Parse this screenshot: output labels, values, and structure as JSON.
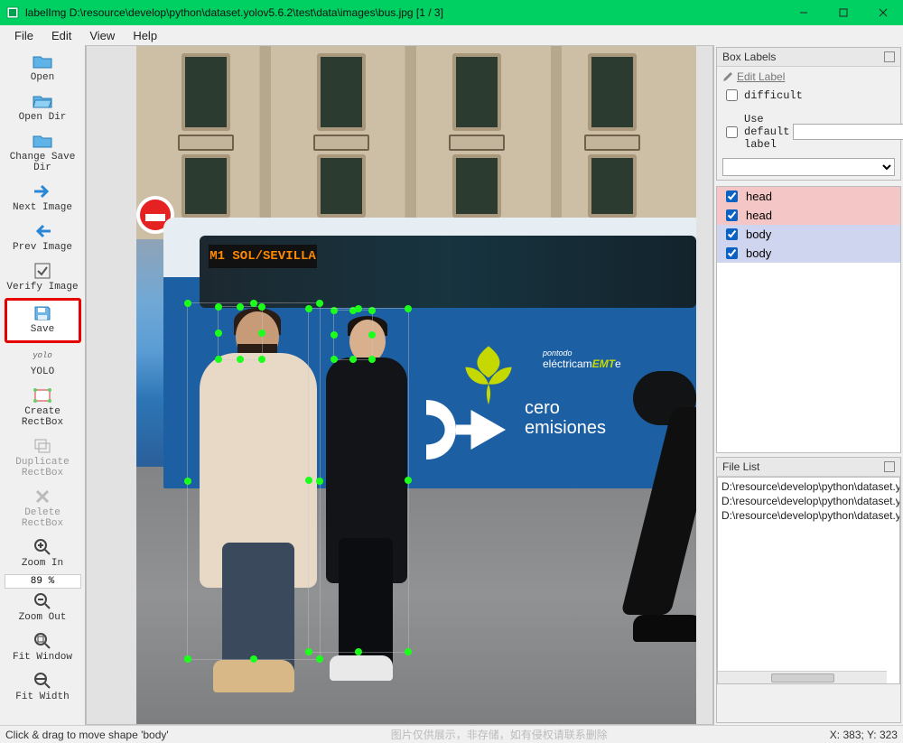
{
  "window": {
    "title": "labelImg D:\\resource\\develop\\python\\dataset.yolov5.6.2\\test\\data\\images\\bus.jpg [1 / 3]"
  },
  "menu": {
    "file": "File",
    "edit": "Edit",
    "view": "View",
    "help": "Help"
  },
  "toolbar": {
    "open": "Open",
    "open_dir": "Open Dir",
    "change_save_dir": "Change Save Dir",
    "next_image": "Next Image",
    "prev_image": "Prev Image",
    "verify_image": "Verify Image",
    "save": "Save",
    "format_small": "yolo",
    "format": "YOLO",
    "create_rect": "Create RectBox",
    "duplicate_rect": "Duplicate RectBox",
    "delete_rect": "Delete RectBox",
    "zoom_in": "Zoom In",
    "zoom_value": "89 %",
    "zoom_out": "Zoom Out",
    "fit_window": "Fit Window",
    "fit_width": "Fit Width"
  },
  "box_labels": {
    "title": "Box Labels",
    "edit_label": "Edit Label",
    "difficult": "difficult",
    "use_default": "Use default label",
    "items": [
      {
        "text": "head",
        "cls": "pink"
      },
      {
        "text": "head",
        "cls": "pink"
      },
      {
        "text": "body",
        "cls": "blue"
      },
      {
        "text": "body",
        "cls": "blue"
      }
    ]
  },
  "file_list": {
    "title": "File List",
    "items": [
      "D:\\resource\\develop\\python\\dataset.yolov5.6",
      "D:\\resource\\develop\\python\\dataset.yolov5.6",
      "D:\\resource\\develop\\python\\dataset.yolov5.6"
    ]
  },
  "scene": {
    "bus_dest": "M1 SOL/SEVILLA",
    "slogan1": "cero",
    "slogan2": "emisiones",
    "brand_pre": "pontodo",
    "brand": "eléctricamEMTe"
  },
  "status": {
    "left": "Click & drag to move shape 'body'",
    "center": "图片仅供展示，非存储，如有侵权请联系删除",
    "right": "X: 383; Y: 323"
  }
}
